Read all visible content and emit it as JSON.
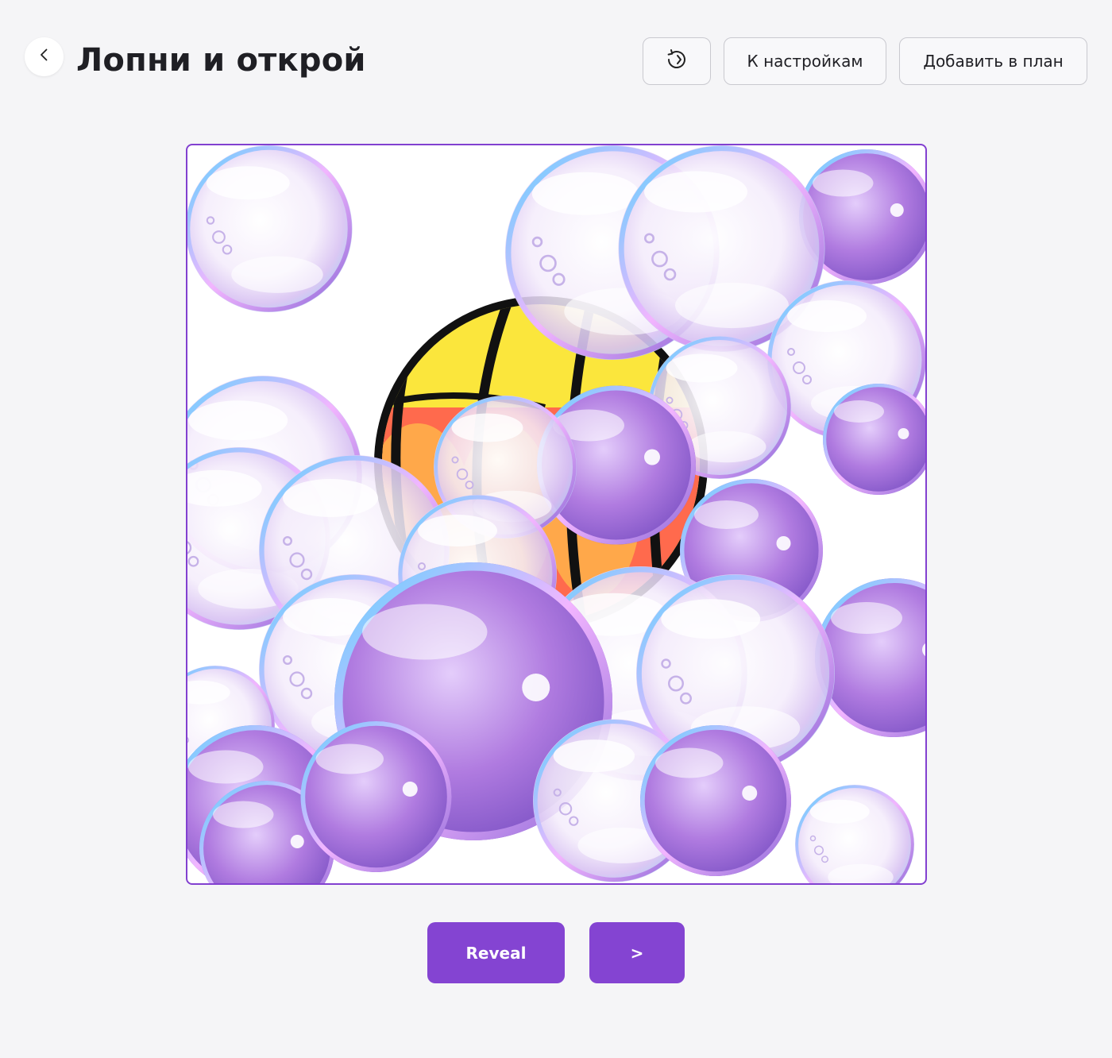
{
  "header": {
    "title": "Лопни и открой",
    "back_icon": "chevron-left-icon",
    "refresh_icon": "refresh-icon",
    "settings_label": "К настройкам",
    "add_to_plan_label": "Добавить в план"
  },
  "board": {
    "hidden_image": "beach-ball",
    "border_color": "#8240d0",
    "bubble_colors": [
      "#ffffff",
      "#cfeaff",
      "#e7c7ff",
      "#b07be0",
      "#7f54c6"
    ]
  },
  "actions": {
    "reveal_label": "Reveal",
    "next_label": ">",
    "button_color": "#8444d2"
  }
}
